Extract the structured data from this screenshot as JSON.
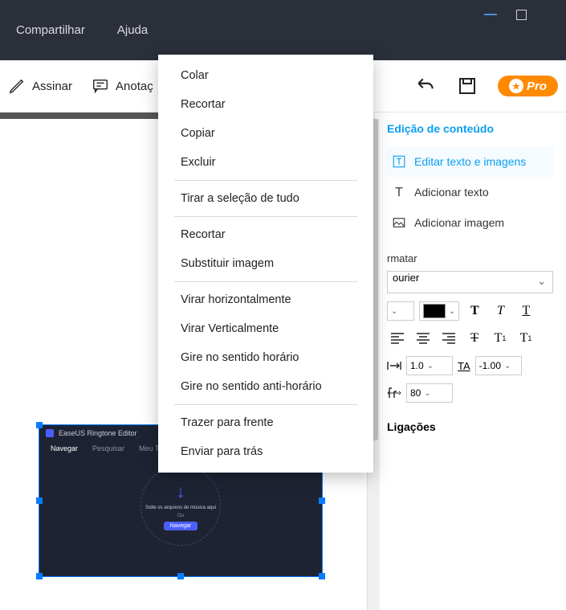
{
  "menubar": {
    "share": "Compartilhar",
    "help": "Ajuda"
  },
  "toolbar": {
    "sign": "Assinar",
    "annotate": "Anotaç",
    "pro": "Pro"
  },
  "context_menu": {
    "items": [
      "Colar",
      "Recortar",
      "Copiar",
      "Excluir",
      "Tirar a seleção de tudo",
      "Recortar",
      "Substituir imagem",
      "Virar horizontalmente",
      "Virar Verticalmente",
      "Gire no sentido horário",
      "Gire no sentido anti-horário",
      "Trazer para frente",
      "Enviar para trás"
    ],
    "separators_after": [
      3,
      4,
      6,
      10
    ]
  },
  "sidebar": {
    "section_title": "Edição de conteúdo",
    "edit_text_images": "Editar texto e imagens",
    "add_text": "Adicionar texto",
    "add_image": "Adicionar imagem",
    "format_title": "rmatar",
    "font_name": "ourier",
    "char_spacing": "1.0",
    "word_spacing": "-1.00",
    "horiz_scale": "80",
    "ligatures_title": "Ligações"
  },
  "embedded_image": {
    "app_title": "EaseUS Ringtone Editor",
    "tabs": {
      "browse": "Navegar",
      "search": "Pesquisar",
      "myringtones": "Meu Toq"
    },
    "drop_text": "Solte os arquivos de música aqui",
    "or": "Ou",
    "browse_btn": "Navegar"
  }
}
